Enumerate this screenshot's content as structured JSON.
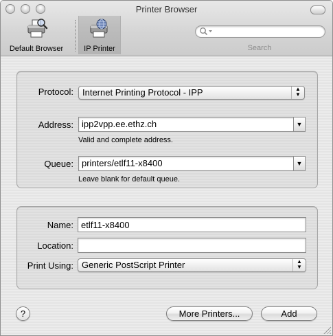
{
  "window": {
    "title": "Printer Browser"
  },
  "toolbar": {
    "items": [
      {
        "label": "Default Browser",
        "icon": "printer-magnifier-icon",
        "selected": false
      },
      {
        "label": "IP Printer",
        "icon": "printer-globe-icon",
        "selected": true
      }
    ],
    "search": {
      "label": "Search",
      "value": "",
      "icon": "search-icon"
    }
  },
  "connection": {
    "protocol_label": "Protocol:",
    "protocol_value": "Internet Printing Protocol - IPP",
    "address_label": "Address:",
    "address_value": "ipp2vpp.ee.ethz.ch",
    "address_hint": "Valid and complete address.",
    "queue_label": "Queue:",
    "queue_value": "printers/etlf11-x8400",
    "queue_hint": "Leave blank for default queue."
  },
  "printer_info": {
    "name_label": "Name:",
    "name_value": "etlf11-x8400",
    "location_label": "Location:",
    "location_value": "",
    "print_using_label": "Print Using:",
    "print_using_value": "Generic PostScript Printer"
  },
  "buttons": {
    "help": "?",
    "more_printers": "More Printers...",
    "add": "Add"
  },
  "colors": {
    "window_bg": "#ececec",
    "selected_toolbar_bg": "#cfcfcf"
  }
}
